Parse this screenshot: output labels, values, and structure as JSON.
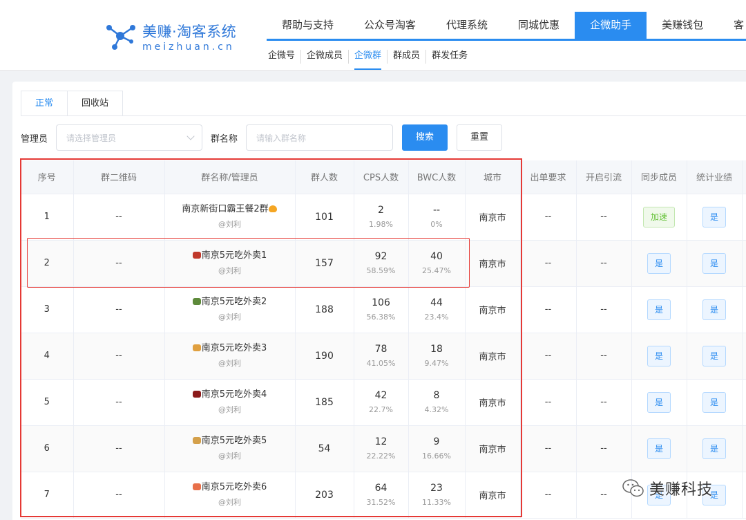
{
  "brand": {
    "name_cn": "美赚·淘客系统",
    "domain": "meizhuan.cn",
    "color": "#2f78d9"
  },
  "main_nav": [
    {
      "label": "帮助与支持",
      "active": false
    },
    {
      "label": "公众号淘客",
      "active": false
    },
    {
      "label": "代理系统",
      "active": false
    },
    {
      "label": "同城优惠",
      "active": false
    },
    {
      "label": "企微助手",
      "active": true
    },
    {
      "label": "美赚钱包",
      "active": false
    },
    {
      "label": "客",
      "active": false
    }
  ],
  "sub_nav": [
    {
      "label": "企微号",
      "active": false
    },
    {
      "label": "企微成员",
      "active": false
    },
    {
      "label": "企微群",
      "active": true
    },
    {
      "label": "群成员",
      "active": false
    },
    {
      "label": "群发任务",
      "active": false
    }
  ],
  "tabs": [
    {
      "label": "正常",
      "active": true
    },
    {
      "label": "回收站",
      "active": false
    }
  ],
  "filters": {
    "admin_label": "管理员",
    "admin_placeholder": "请选择管理员",
    "group_label": "群名称",
    "group_placeholder": "请输入群名称",
    "search_btn": "搜索",
    "reset_btn": "重置"
  },
  "table": {
    "columns": [
      "序号",
      "群二维码",
      "群名称/管理员",
      "群人数",
      "CPS人数",
      "BWC人数",
      "城市",
      "出单要求",
      "开启引流",
      "同步成员",
      "统计业绩"
    ],
    "rows": [
      {
        "idx": "1",
        "qr": "--",
        "name": "南京新街口霸王餐2群",
        "emoji": "🔥",
        "emoji_pos": "after",
        "emoji_color": "#f5a623",
        "admin": "@刘利",
        "members": "101",
        "cps": "2",
        "cps_pct": "1.98%",
        "bwc": "--",
        "bwc_pct": "0%",
        "city": "南京市",
        "order_req": "--",
        "traffic": "--",
        "sync": "加速",
        "sync_style": "green",
        "stats": "是"
      },
      {
        "idx": "2",
        "qr": "--",
        "name": "南京5元吃外卖1",
        "emoji": "🍱",
        "emoji_pos": "before",
        "emoji_color": "#c0392b",
        "admin": "@刘利",
        "members": "157",
        "cps": "92",
        "cps_pct": "58.59%",
        "bwc": "40",
        "bwc_pct": "25.47%",
        "city": "南京市",
        "order_req": "--",
        "traffic": "--",
        "sync": "是",
        "sync_style": "blue",
        "stats": "是"
      },
      {
        "idx": "3",
        "qr": "--",
        "name": "南京5元吃外卖2",
        "emoji": "🥗",
        "emoji_pos": "before",
        "emoji_color": "#5d8a3a",
        "admin": "@刘利",
        "members": "188",
        "cps": "106",
        "cps_pct": "56.38%",
        "bwc": "44",
        "bwc_pct": "23.4%",
        "city": "南京市",
        "order_req": "--",
        "traffic": "--",
        "sync": "是",
        "sync_style": "blue",
        "stats": "是"
      },
      {
        "idx": "4",
        "qr": "--",
        "name": "南京5元吃外卖3",
        "emoji": "🥟",
        "emoji_pos": "before",
        "emoji_color": "#e0a040",
        "admin": "@刘利",
        "members": "190",
        "cps": "78",
        "cps_pct": "41.05%",
        "bwc": "18",
        "bwc_pct": "9.47%",
        "city": "南京市",
        "order_req": "--",
        "traffic": "--",
        "sync": "是",
        "sync_style": "blue",
        "stats": "是"
      },
      {
        "idx": "5",
        "qr": "--",
        "name": "南京5元吃外卖4",
        "emoji": "🍙",
        "emoji_pos": "before",
        "emoji_color": "#8b1a1a",
        "admin": "@刘利",
        "members": "185",
        "cps": "42",
        "cps_pct": "22.7%",
        "bwc": "8",
        "bwc_pct": "4.32%",
        "city": "南京市",
        "order_req": "--",
        "traffic": "--",
        "sync": "是",
        "sync_style": "blue",
        "stats": "是"
      },
      {
        "idx": "6",
        "qr": "--",
        "name": "南京5元吃外卖5",
        "emoji": "🥘",
        "emoji_pos": "before",
        "emoji_color": "#d4a04a",
        "admin": "@刘利",
        "members": "54",
        "cps": "12",
        "cps_pct": "22.22%",
        "bwc": "9",
        "bwc_pct": "16.66%",
        "city": "南京市",
        "order_req": "--",
        "traffic": "--",
        "sync": "是",
        "sync_style": "blue",
        "stats": "是"
      },
      {
        "idx": "7",
        "qr": "--",
        "name": "南京5元吃外卖6",
        "emoji": "🍣",
        "emoji_pos": "before",
        "emoji_color": "#e8704a",
        "admin": "@刘利",
        "members": "203",
        "cps": "64",
        "cps_pct": "31.52%",
        "bwc": "23",
        "bwc_pct": "11.33%",
        "city": "南京市",
        "order_req": "--",
        "traffic": "--",
        "sync": "是",
        "sync_style": "blue",
        "stats": "是"
      }
    ]
  },
  "watermark": {
    "text": "美赚科技",
    "icon": "wechat-icon"
  },
  "colors": {
    "accent": "#2a8cf0",
    "annotation_red": "#e53935",
    "success_green": "#67c23a"
  }
}
